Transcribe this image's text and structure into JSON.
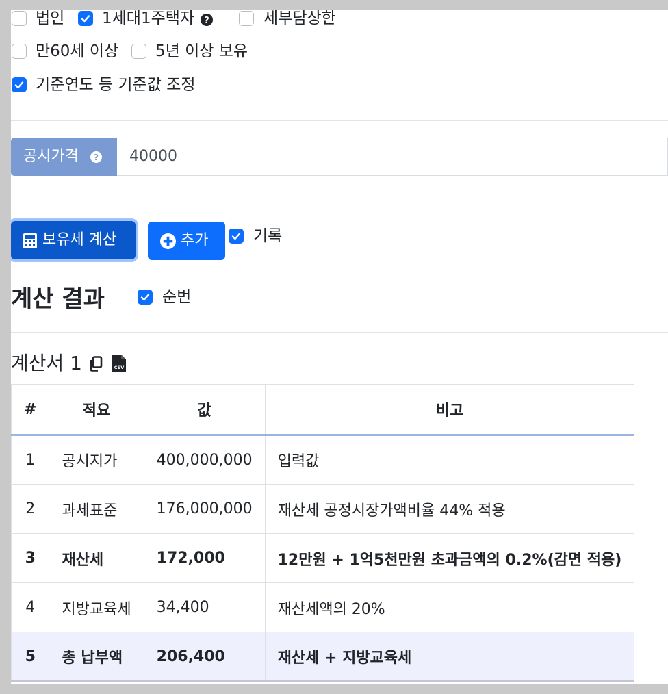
{
  "options": {
    "corporation": {
      "label": "법인",
      "checked": false
    },
    "one_house": {
      "label": "1세대1주택자",
      "checked": true
    },
    "joint_owner": {
      "label": "세부담상한",
      "checked": false
    },
    "age60": {
      "label": "만60세 이상",
      "checked": false
    },
    "hold5y": {
      "label": "5년 이상 보유",
      "checked": false
    },
    "adjust_base": {
      "label": "기준연도 등 기준값 조정",
      "checked": true
    }
  },
  "price_input": {
    "label": "공시가격",
    "value": "40000"
  },
  "buttons": {
    "calculate": "보유세 계산",
    "add": "추가",
    "record_label": "기록",
    "record_checked": true
  },
  "result": {
    "heading": "계산 결과",
    "order_label": "순번",
    "order_checked": true
  },
  "sheet": {
    "title": "계산서 1",
    "columns": [
      "#",
      "적요",
      "값",
      "비고"
    ],
    "rows": [
      {
        "no": "1",
        "item": "공시지가",
        "value": "400,000,000",
        "note": "입력값"
      },
      {
        "no": "2",
        "item": "과세표준",
        "value": "176,000,000",
        "note": "재산세 공정시장가액비율 44% 적용"
      },
      {
        "no": "3",
        "item": "재산세",
        "value": "172,000",
        "note": "12만원 + 1억5천만원 초과금액의 0.2%(감면 적용)"
      },
      {
        "no": "4",
        "item": "지방교육세",
        "value": "34,400",
        "note": "재산세액의 20%"
      },
      {
        "no": "5",
        "item": "총 납부액",
        "value": "206,400",
        "note": "재산세 + 지방교육세"
      }
    ]
  },
  "colors": {
    "primary": "#0d6efd",
    "input_label_bg": "#7a9ad4",
    "total_row_bg": "#eef0fd"
  }
}
